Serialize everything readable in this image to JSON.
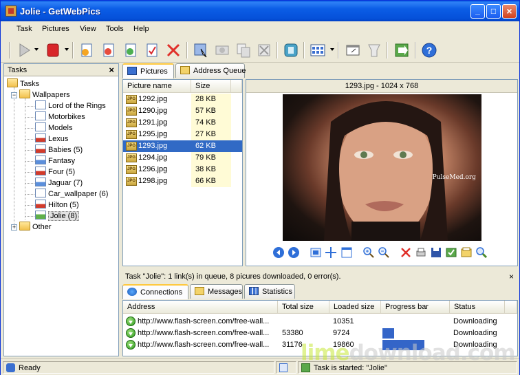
{
  "window": {
    "title": "Jolie - GetWebPics"
  },
  "menu": [
    "Task",
    "Pictures",
    "View",
    "Tools",
    "Help"
  ],
  "tasks_panel": {
    "title": "Tasks",
    "root": "Tasks",
    "wallpapers": "Wallpapers",
    "items": [
      "Lord of the Rings",
      "Motorbikes",
      "Models",
      "Lexus",
      "Babies (5)",
      "Fantasy",
      "Four (5)",
      "Jaguar (7)",
      "Car_wallpaper (6)",
      "Hilton (5)",
      "Jolie (8)"
    ],
    "other": "Other"
  },
  "tabs": {
    "pictures": "Pictures",
    "address_queue": "Address Queue"
  },
  "file_list": {
    "headers": {
      "name": "Picture name",
      "size": "Size"
    },
    "rows": [
      {
        "name": "1292.jpg",
        "size": "28 KB"
      },
      {
        "name": "1290.jpg",
        "size": "57 KB"
      },
      {
        "name": "1291.jpg",
        "size": "74 KB"
      },
      {
        "name": "1295.jpg",
        "size": "27 KB"
      },
      {
        "name": "1293.jpg",
        "size": "62 KB"
      },
      {
        "name": "1294.jpg",
        "size": "79 KB"
      },
      {
        "name": "1296.jpg",
        "size": "38 KB"
      },
      {
        "name": "1298.jpg",
        "size": "66 KB"
      }
    ],
    "selected_index": 4
  },
  "preview": {
    "title": "1293.jpg - 1024 x 768",
    "watermark": "PulseMed.org"
  },
  "task_status": "Task \"Jolie\":    1 link(s) in queue,     8 picures downloaded,     0 error(s).",
  "bottom_tabs": {
    "connections": "Connections",
    "messages": "Messages",
    "statistics": "Statistics"
  },
  "connections": {
    "headers": {
      "address": "Address",
      "total": "Total size",
      "loaded": "Loaded size",
      "progress": "Progress bar",
      "status": "Status"
    },
    "rows": [
      {
        "address": "http://www.flash-screen.com/free-wall...",
        "total": "",
        "loaded": "10351",
        "progress": 0,
        "status": "Downloading"
      },
      {
        "address": "http://www.flash-screen.com/free-wall...",
        "total": "53380",
        "loaded": "9724",
        "progress": 0.18,
        "status": "Downloading"
      },
      {
        "address": "http://www.flash-screen.com/free-wall...",
        "total": "31176",
        "loaded": "19860",
        "progress": 0.64,
        "status": "Downloading"
      }
    ]
  },
  "statusbar": {
    "ready": "Ready",
    "task": "Task is started: \"Jolie\""
  },
  "watermark": {
    "part1": "lime",
    "part2": "download.com"
  }
}
